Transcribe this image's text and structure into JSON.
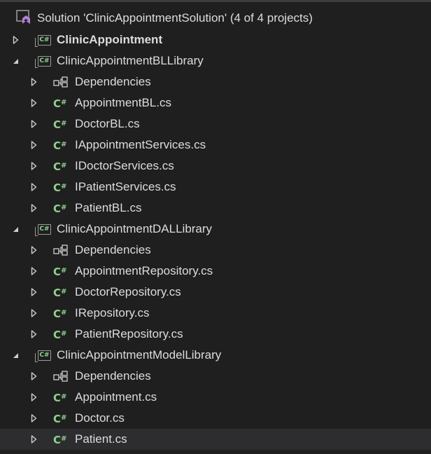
{
  "solution": {
    "label": "Solution 'ClinicAppointmentSolution' (4 of 4 projects)"
  },
  "projects": [
    {
      "name": "ClinicAppointment",
      "expanded": false,
      "bold": true,
      "items": []
    },
    {
      "name": "ClinicAppointmentBLLibrary",
      "expanded": true,
      "items": [
        {
          "label": "Dependencies",
          "icon": "dependencies-icon"
        },
        {
          "label": "AppointmentBL.cs",
          "icon": "csharp-file-icon"
        },
        {
          "label": "DoctorBL.cs",
          "icon": "csharp-file-icon"
        },
        {
          "label": "IAppointmentServices.cs",
          "icon": "csharp-file-icon"
        },
        {
          "label": "IDoctorServices.cs",
          "icon": "csharp-file-icon"
        },
        {
          "label": "IPatientServices.cs",
          "icon": "csharp-file-icon"
        },
        {
          "label": "PatientBL.cs",
          "icon": "csharp-file-icon"
        }
      ]
    },
    {
      "name": "ClinicAppointmentDALLibrary",
      "expanded": true,
      "items": [
        {
          "label": "Dependencies",
          "icon": "dependencies-icon"
        },
        {
          "label": "AppointmentRepository.cs",
          "icon": "csharp-file-icon"
        },
        {
          "label": "DoctorRepository.cs",
          "icon": "csharp-file-icon"
        },
        {
          "label": "IRepository.cs",
          "icon": "csharp-file-icon"
        },
        {
          "label": "PatientRepository.cs",
          "icon": "csharp-file-icon"
        }
      ]
    },
    {
      "name": "ClinicAppointmentModelLibrary",
      "expanded": true,
      "items": [
        {
          "label": "Dependencies",
          "icon": "dependencies-icon"
        },
        {
          "label": "Appointment.cs",
          "icon": "csharp-file-icon"
        },
        {
          "label": "Doctor.cs",
          "icon": "csharp-file-icon"
        },
        {
          "label": "Patient.cs",
          "icon": "csharp-file-icon",
          "selected": true
        }
      ]
    }
  ],
  "icons": {
    "project_glyph": "C#",
    "file_glyph_c": "C",
    "file_glyph_sharp": "#"
  },
  "colors": {
    "background": "#1f1f1f",
    "text": "#dcdcdc",
    "csharp_green": "#8fd18f",
    "solution_purple": "#b180d7",
    "selected_row": "#2d2d30"
  }
}
